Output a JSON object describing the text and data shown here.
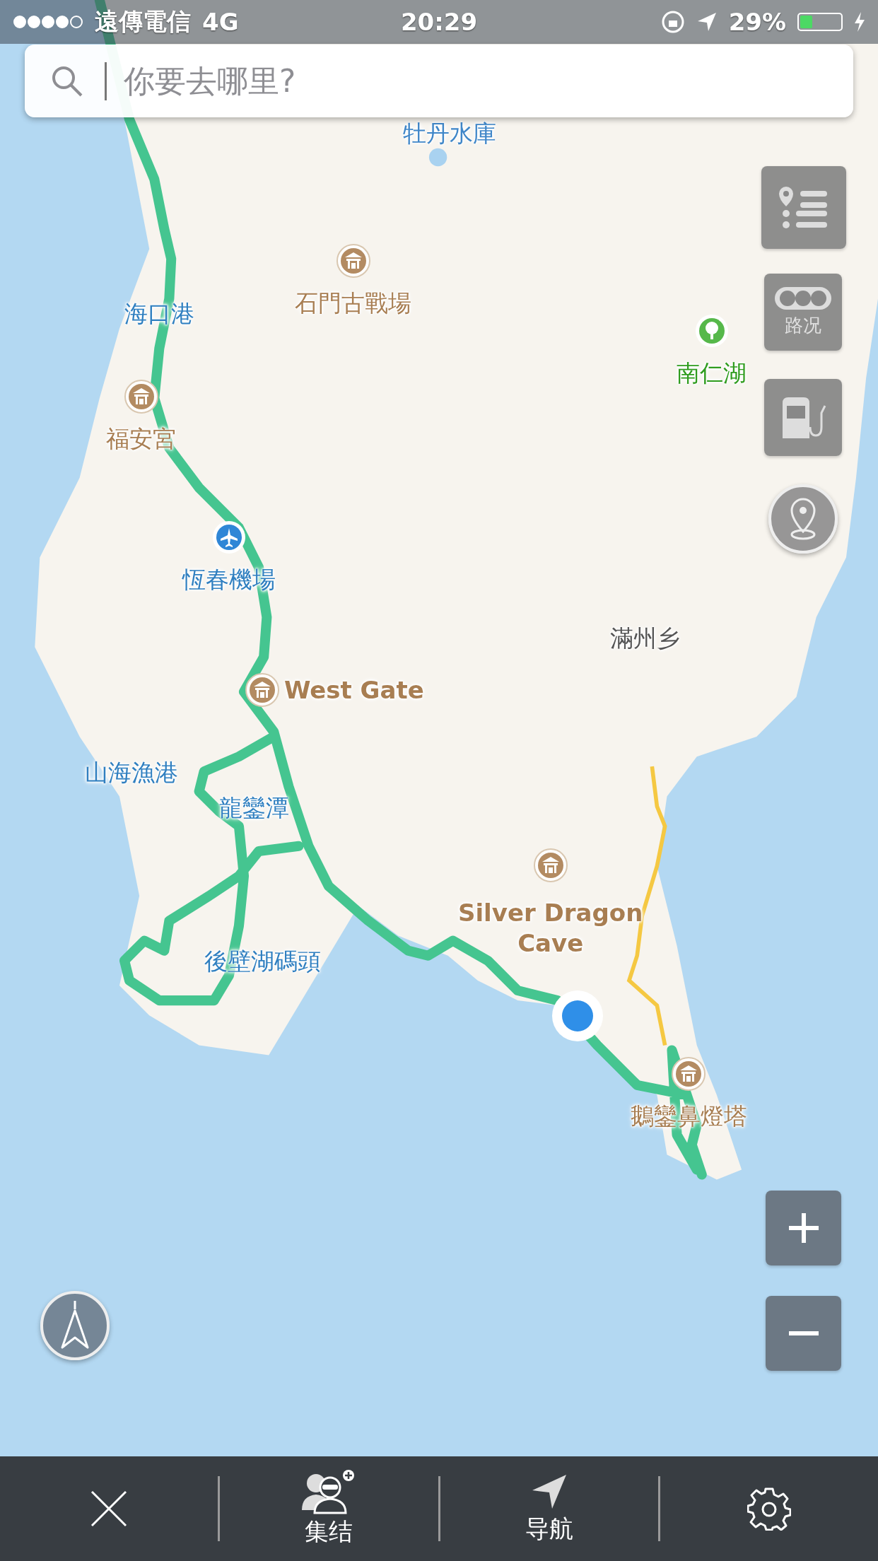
{
  "status_bar": {
    "carrier": "遠傳電信",
    "network": "4G",
    "time": "20:29",
    "battery": "29%"
  },
  "search": {
    "placeholder": "你要去哪里?"
  },
  "map": {
    "labels": [
      {
        "text": "牡丹水庫",
        "kind": "water_faint"
      },
      {
        "text": "海口港",
        "kind": "water"
      },
      {
        "text": "石門古戰場",
        "kind": "landmark"
      },
      {
        "text": "南仁湖",
        "kind": "park"
      },
      {
        "text": "福安宮",
        "kind": "landmark"
      },
      {
        "text": "恆春機場",
        "kind": "airport"
      },
      {
        "text": "滿州乡",
        "kind": "region"
      },
      {
        "text": "West Gate",
        "kind": "landmark"
      },
      {
        "text": "山海漁港",
        "kind": "water"
      },
      {
        "text": "龍鑾潭",
        "kind": "water"
      },
      {
        "text": "Silver Dragon Cave",
        "kind": "landmark"
      },
      {
        "text": "後壁湖碼頭",
        "kind": "water"
      },
      {
        "text": "鵝鑾鼻燈塔",
        "kind": "landmark"
      }
    ]
  },
  "side_buttons": {
    "traffic_label": "路况"
  },
  "bottom_bar": {
    "items": [
      {
        "kind": "close"
      },
      {
        "kind": "rally",
        "label": "集结"
      },
      {
        "kind": "navigate",
        "label": "导航"
      },
      {
        "kind": "settings"
      }
    ]
  }
}
